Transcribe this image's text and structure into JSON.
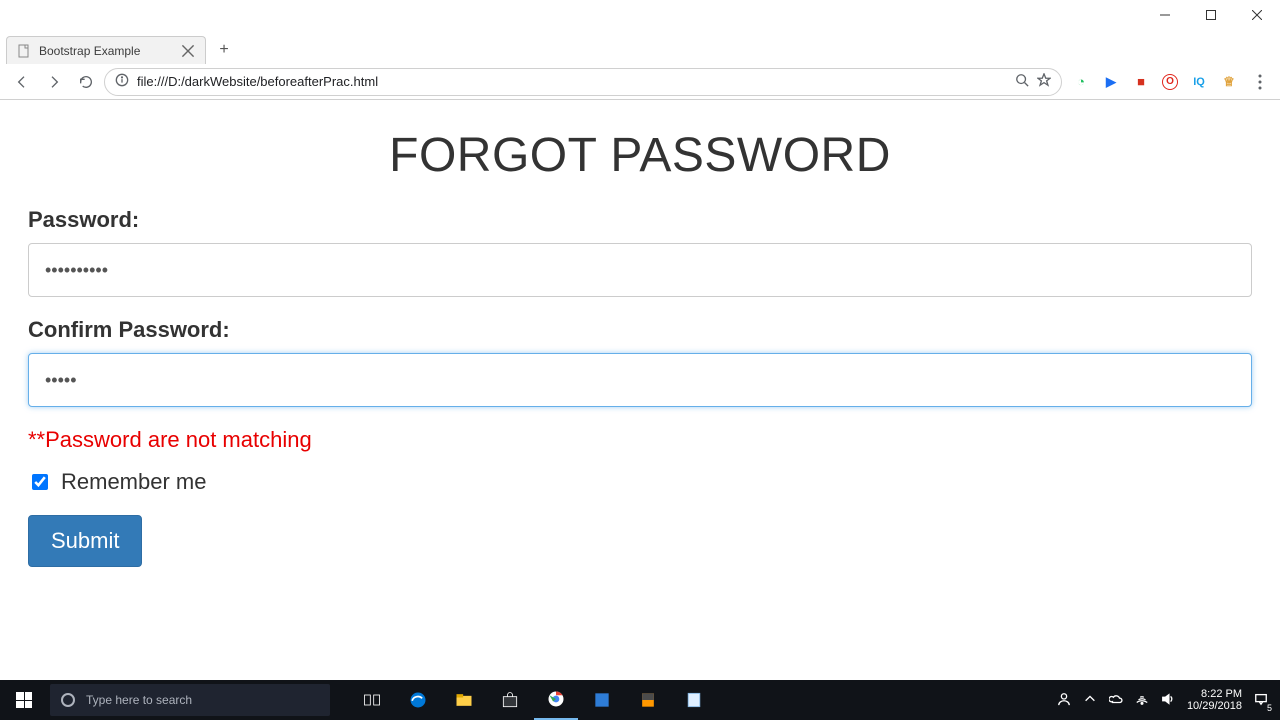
{
  "window": {
    "minimize": "–",
    "maximize": "□",
    "close": "×"
  },
  "browser": {
    "tab_title": "Bootstrap Example",
    "newtab": "+",
    "url_prefix_icon": "ⓘ",
    "url": "file:///D:/darkWebsite/beforeafterPrac.html",
    "extensions": [
      {
        "name": "ext-green",
        "glyph": "◔",
        "color": "#1fbf5f"
      },
      {
        "name": "ext-blue",
        "glyph": "▶",
        "color": "#1b6ef3"
      },
      {
        "name": "ext-red",
        "glyph": "■",
        "color": "#d6311f"
      },
      {
        "name": "ext-opera",
        "glyph": "O",
        "color": "#e1261c"
      },
      {
        "name": "ext-iq",
        "glyph": "IQ",
        "color": "#1aa0e8"
      },
      {
        "name": "ext-crown",
        "glyph": "♕",
        "color": "#e0a23b"
      }
    ]
  },
  "page": {
    "heading": "FORGOT PASSWORD",
    "password_label": "Password:",
    "password_value": "••••••••••",
    "confirm_label": "Confirm Password:",
    "confirm_value": "•••••",
    "error": "**Password are not matching",
    "remember_label": "Remember me",
    "remember_checked": true,
    "submit_label": "Submit"
  },
  "taskbar": {
    "search_placeholder": "Type here to search",
    "clock_time": "8:22 PM",
    "clock_date": "10/29/2018",
    "notification_count": "5"
  }
}
